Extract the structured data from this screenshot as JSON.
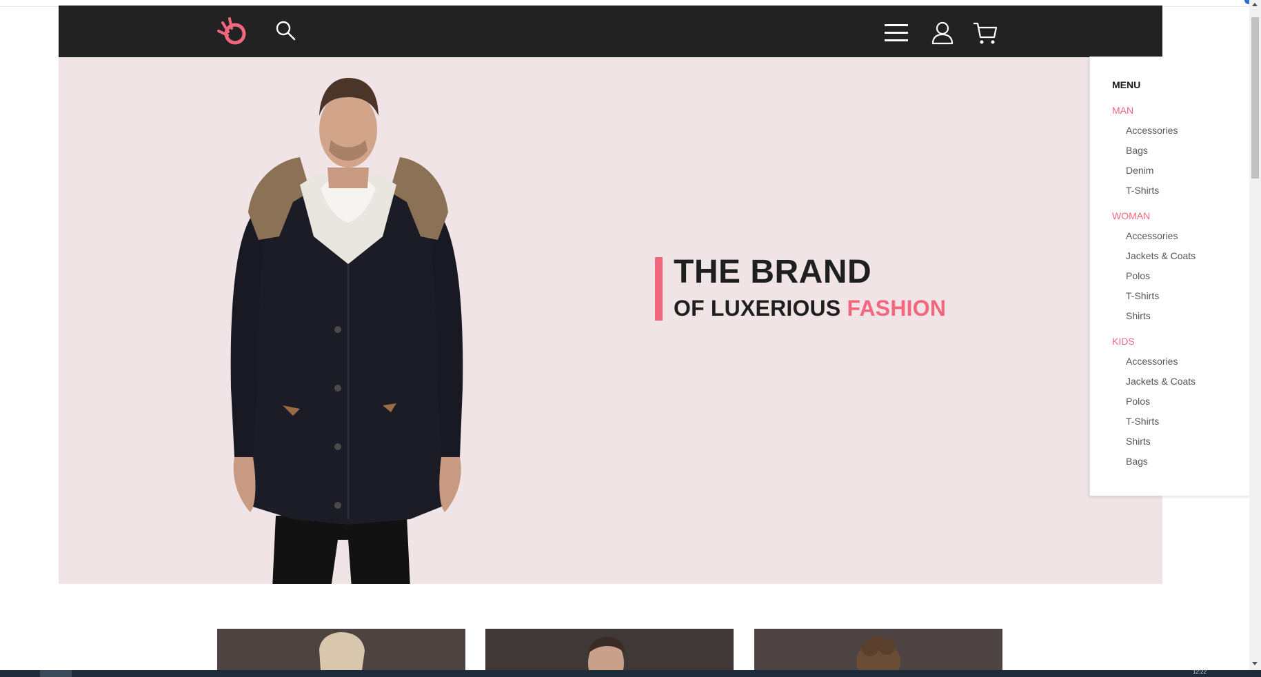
{
  "header": {
    "logo": "brand-logo",
    "icons": [
      "search-icon",
      "hamburger-menu-icon",
      "user-icon",
      "cart-icon"
    ]
  },
  "hero": {
    "title": "THE BRAND",
    "subtitle_main": "OF LUXERIOUS",
    "subtitle_accent": "FASHION"
  },
  "menu": {
    "title": "MENU",
    "categories": [
      {
        "label": "MAN",
        "items": [
          "Accessories",
          "Bags",
          "Denim",
          "T-Shirts"
        ]
      },
      {
        "label": "WOMAN",
        "items": [
          "Accessories",
          "Jackets & Coats",
          "Polos",
          "T-Shirts",
          "Shirts"
        ]
      },
      {
        "label": "KIDS",
        "items": [
          "Accessories",
          "Jackets & Coats",
          "Polos",
          "T-Shirts",
          "Shirts",
          "Bags"
        ]
      }
    ]
  },
  "taskbar": {
    "time": "12:22"
  },
  "colors": {
    "accent": "#f2677e",
    "navbar": "#222222",
    "hero_bg": "#f0e4e7",
    "text_dark": "#1f1f1f"
  }
}
